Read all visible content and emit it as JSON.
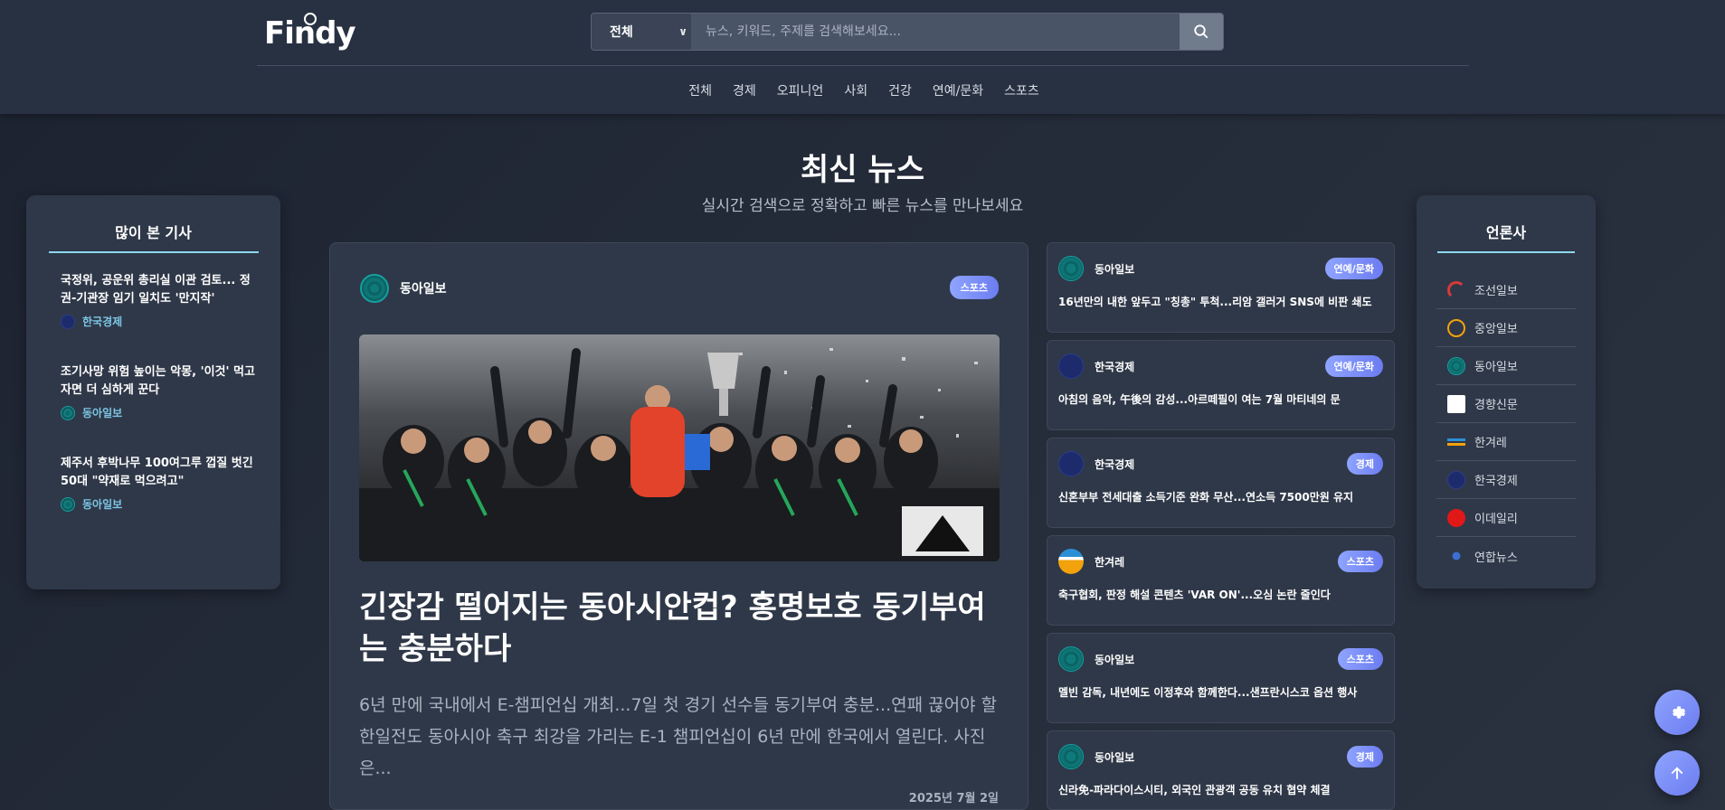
{
  "header": {
    "logo": "Findy",
    "search": {
      "category": "전체",
      "placeholder": "뉴스, 키워드, 주제를 검색해보세요..."
    },
    "nav": [
      "전체",
      "경제",
      "오피니언",
      "사회",
      "건강",
      "연예/문화",
      "스포츠"
    ]
  },
  "page": {
    "title": "최신 뉴스",
    "subtitle": "실시간 검색으로 정확하고 빠른 뉴스를 만나보세요"
  },
  "popular": {
    "title": "많이 본 기사",
    "items": [
      {
        "title": "국정위, 공운위 총리실 이관 검토... 정권-기관장 임기 일치도 '만지작'",
        "source": "한국경제",
        "icon": "hankyung-icon"
      },
      {
        "title": "조기사망 위험 높이는 악몽, '이것' 먹고자면 더 심하게 꾼다",
        "source": "동아일보",
        "icon": "donga-icon"
      },
      {
        "title": "제주서 후박나무 100여그루 껍질 벗긴 50대 \"약재로 먹으려고\"",
        "source": "동아일보",
        "icon": "donga-icon"
      }
    ]
  },
  "featured": {
    "source": "동아일보",
    "tag": "스포츠",
    "title": "긴장감 떨어지는 동아시안컵? 홍명보호 동기부여는 충분하다",
    "summary": "6년 만에 국내에서 E-챔피언십 개최...7일 첫 경기 선수들 동기부여 충분...연패 끊어야 할 한일전도 동아시아 축구 최강을 가리는 E-1 챔피언십이 6년 만에 한국에서 열린다. 사진은...",
    "date": "2025년 7월 2일"
  },
  "side_news": [
    {
      "source": "동아일보",
      "tag": "연예/문화",
      "title": "16년만의 내한 앞두고 \"칭총\" 투척...리암 갤러거 SNS에 비판 쇄도"
    },
    {
      "source": "한국경제",
      "tag": "연예/문화",
      "title": "아침의 음악, 午後의 감성...아르떼필이 여는 7월 마티네의 문"
    },
    {
      "source": "한국경제",
      "tag": "경제",
      "title": "신혼부부 전세대출 소득기준 완화 무산...연소득 7500만원 유지"
    },
    {
      "source": "한겨레",
      "tag": "스포츠",
      "title": "축구협회, 판정 해설 콘텐츠 'VAR ON'...오심 논란 줄인다"
    },
    {
      "source": "동아일보",
      "tag": "스포츠",
      "title": "멜빈 감독, 내년에도 이정후와 함께한다...샌프란시스코 옵션 행사"
    },
    {
      "source": "동아일보",
      "tag": "경제",
      "title": "신라免-파라다이스시티, 외국인 관광객 공동 유치 협약 체결"
    }
  ],
  "press": {
    "title": "언론사",
    "items": [
      {
        "name": "조선일보",
        "icon": "chosun-icon",
        "color": "#d93a3a"
      },
      {
        "name": "중앙일보",
        "icon": "joongang-icon",
        "color": "#f2a20c"
      },
      {
        "name": "동아일보",
        "icon": "donga-icon",
        "color": "#0e7a7a"
      },
      {
        "name": "경향신문",
        "icon": "kyunghyang-icon",
        "color": "#ffffff"
      },
      {
        "name": "한겨레",
        "icon": "hani-icon",
        "color": "#2b8fd6"
      },
      {
        "name": "한국경제",
        "icon": "hankyung-icon",
        "color": "#1d2b6d"
      },
      {
        "name": "이데일리",
        "icon": "edaily-icon",
        "color": "#e01818"
      },
      {
        "name": "연합뉴스",
        "icon": "yonhap-icon",
        "color": "#1b4aa0"
      }
    ]
  },
  "colors": {
    "background": "#232a38",
    "header": "#283142",
    "card": "#2f3848",
    "accent": "#8fd6ef",
    "tag_gradient_start": "#8fa4ff",
    "tag_gradient_end": "#6c7cf0"
  },
  "fab": [
    "settings-icon",
    "arrow-up-icon"
  ]
}
